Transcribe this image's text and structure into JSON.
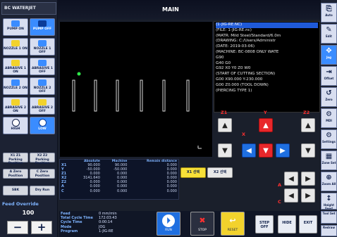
{
  "app": {
    "logo": "BC WATERJET",
    "title": "MAIN"
  },
  "left_buttons": [
    {
      "label": "PUMP ON",
      "color": "#3a8cff"
    },
    {
      "label": "PUMP OFF",
      "color": "#3a8cff"
    },
    {
      "label": "NOZZLE 1 ON",
      "color": "#f2d22c"
    },
    {
      "label": "NOZZLE 1 OFF",
      "color": "#3a8cff"
    },
    {
      "label": "ABRASIVE 1 ON",
      "color": "#f2d22c"
    },
    {
      "label": "ABRASIVE 1 OFF",
      "color": "#3a8cff"
    },
    {
      "label": "NOZZLE 2 ON",
      "color": "#3a8cff"
    },
    {
      "label": "NOZZLE 2 OFF",
      "color": "#3a8cff"
    },
    {
      "label": "ABRASIVE 2 ON",
      "color": "#f2d22c"
    },
    {
      "label": "ABRASIVE 2 OFF",
      "color": "#f2d22c"
    },
    {
      "label": "HIGH",
      "color": "#3a8cff"
    },
    {
      "label": "LOW",
      "color": "#3a8cff"
    }
  ],
  "gray_buttons": [
    "X1 Z1 Parking Position",
    "X2 Z2 Parking Position",
    "A Zero Position",
    "C Zero Position",
    "SBK",
    "Dry Run"
  ],
  "feed_override": {
    "label": "Feed Override",
    "value": "100",
    "minus": "−",
    "plus": "+"
  },
  "gcode_lines": [
    "(1-JIG-RE.NC)",
    "(FILE: 1-JIG-RE.nc)",
    "(MATR: Mild Steel/Standard/6.0m",
    "(DRAWING: C:/Users/Administr",
    "(DATE: 2019-03-06)",
    "(MACHINE: BC-0808 ONLY WATE",
    "G90",
    "G40 G0",
    "G92 X0 Y0 Z0 W0",
    "(START OF CUTTING SECTION)",
    "G00 X90.000 Y-230.000",
    "G00 Z0.000 (TOOL DOWN)",
    "(PIERCING TYPE 1)"
  ],
  "jog": {
    "z1": "Z1",
    "y": "Y",
    "z2": "Z2",
    "x": "X",
    "a": "A",
    "c": "C",
    "up": "▲",
    "down": "▼",
    "left": "◀",
    "right": "▶"
  },
  "coords": {
    "headers": [
      "Absolute",
      "Machine",
      "Remain distance"
    ],
    "rows": [
      {
        "axis": "X1",
        "abs": "90.000",
        "mach": "90.000",
        "rem": "0.000"
      },
      {
        "axis": "Y",
        "abs": "-50.000",
        "mach": "-50.000",
        "rem": "0.000"
      },
      {
        "axis": "Z1",
        "abs": "0.000",
        "mach": "0.000",
        "rem": "0.000"
      },
      {
        "axis": "X2",
        "abs": "3141.640",
        "mach": "0.000",
        "rem": "0.000"
      },
      {
        "axis": "Z2",
        "abs": "0.000",
        "mach": "0.000",
        "rem": "0.000"
      },
      {
        "axis": "A",
        "abs": "0.000",
        "mach": "0.000",
        "rem": "0.000"
      },
      {
        "axis": "C",
        "abs": "0.000",
        "mach": "0.000",
        "rem": "0.000"
      }
    ]
  },
  "select_buttons": {
    "x1": "X1 선택",
    "x2": "X2 선택"
  },
  "info": {
    "feed_k": "Feed",
    "feed_v": "0 mm/min",
    "total_k": "Total Cycle Time",
    "total_v": "172:03:43",
    "cycle_k": "Cycle Time",
    "cycle_v": "0:00:14",
    "mode_k": "Mode",
    "mode_v": "JOG",
    "program_k": "Program",
    "program_v": "1-JIG-RE"
  },
  "actions": {
    "run": "RUN",
    "stop": "STOP",
    "reset": "RESET",
    "step_off": "STEP OFF",
    "hide": "HIDE",
    "exit": "EXIT"
  },
  "right_strip": [
    "Auto",
    "Edit",
    "Jog",
    "Offset",
    "Zero",
    "MDI",
    "Settings",
    "Zone Set",
    "Zoom All",
    "Height Feed",
    "Tool Set",
    "Redraw"
  ]
}
